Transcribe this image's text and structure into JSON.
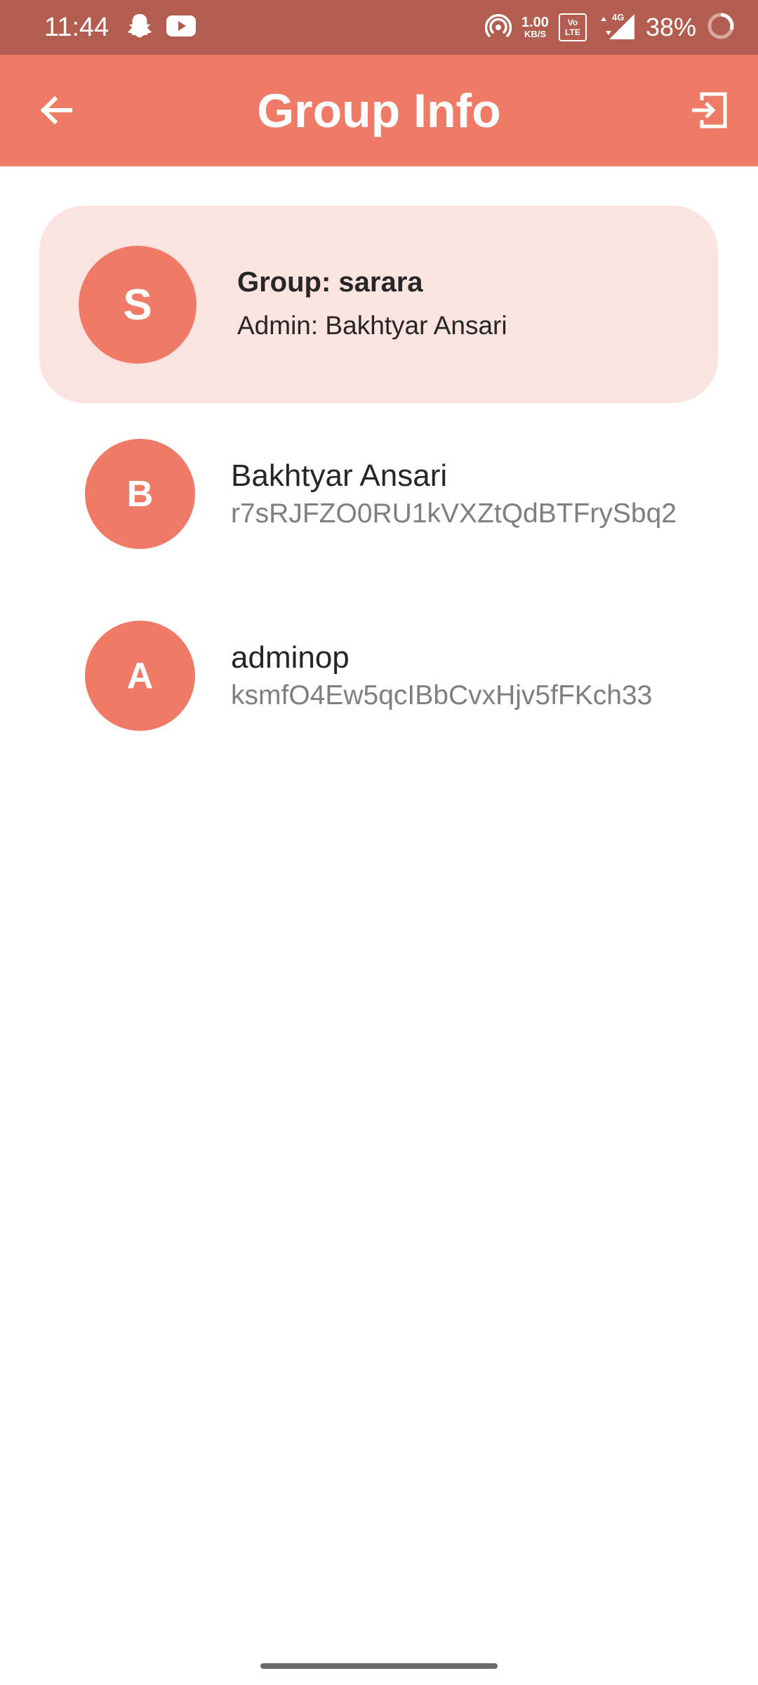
{
  "status_bar": {
    "time": "11:44",
    "net_speed_value": "1.00",
    "net_speed_unit": "KB/S",
    "volte_top": "Vo",
    "volte_bottom": "LTE",
    "network_type": "4G",
    "battery": "38%"
  },
  "app_bar": {
    "title": "Group Info",
    "back_icon": "arrow-left-icon",
    "exit_icon": "exit-icon"
  },
  "group": {
    "avatar_letter": "S",
    "name": "Group: sarara",
    "admin": "Admin: Bakhtyar Ansari"
  },
  "members": [
    {
      "avatar_letter": "B",
      "name": "Bakhtyar Ansari",
      "id": "r7sRJFZO0RU1kVXZtQdBTFrySbq2"
    },
    {
      "avatar_letter": "A",
      "name": "adminop",
      "id": "ksmfO4Ew5qcIBbCvxHjv5fFKch33"
    }
  ],
  "colors": {
    "status_bar": "#b25d4f",
    "app_bar": "#ef7b67",
    "avatar": "#ef7b67",
    "group_card": "#fbe4e0",
    "secondary_text": "#7f7f7f"
  }
}
